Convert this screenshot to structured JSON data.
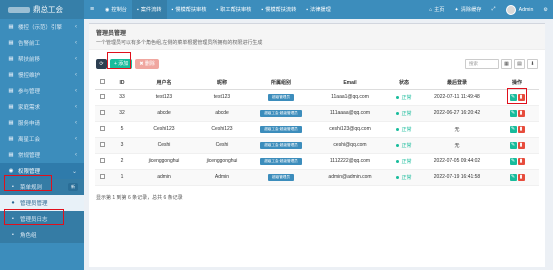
{
  "sidebar": {
    "logo_text": "鼎总工会",
    "items": [
      {
        "icon": "▦",
        "label": "楼控（示范）引擎",
        "arrow": "‹"
      },
      {
        "icon": "▦",
        "label": "告警前工",
        "arrow": "‹"
      },
      {
        "icon": "▦",
        "label": "帮扶前移",
        "arrow": "‹"
      },
      {
        "icon": "▦",
        "label": "慢控维护",
        "arrow": "‹"
      },
      {
        "icon": "▦",
        "label": "参与管理",
        "arrow": "‹"
      },
      {
        "icon": "▦",
        "label": "家庭需求",
        "arrow": "‹"
      },
      {
        "icon": "▦",
        "label": "服务申请",
        "arrow": "‹"
      },
      {
        "icon": "▦",
        "label": "离星工会",
        "arrow": "‹"
      },
      {
        "icon": "▦",
        "label": "常规管理",
        "arrow": "‹"
      },
      {
        "icon": "◉",
        "label": "权限管理",
        "arrow": "⌄"
      },
      {
        "icon": "▪",
        "label": "菜单规则",
        "badge": "新"
      },
      {
        "icon": "●",
        "label": "管理员管理"
      },
      {
        "icon": "▪",
        "label": "管理员日志"
      },
      {
        "icon": "▪",
        "label": "角色组"
      }
    ]
  },
  "topbar": {
    "burger": "≡",
    "tabs": [
      {
        "icon": "◉",
        "label": "控制台"
      },
      {
        "icon": "▪",
        "label": "案件流转"
      },
      {
        "icon": "▪",
        "label": "慢模帮扶审核"
      },
      {
        "icon": "▪",
        "label": "职工帮扶审核"
      },
      {
        "icon": "▪",
        "label": "慢模帮扶流转"
      },
      {
        "icon": "▪",
        "label": "法律援理"
      }
    ],
    "right": {
      "home": "主页",
      "clear_cache": "清除缓存",
      "fullscreen": "⤢",
      "user": "Admin",
      "settings": "⚙"
    }
  },
  "panel": {
    "title": "管理员管理",
    "desc": "一个管理员可以有多个角色组,左侧的菜单根据管理员所拥有的权限进行生成"
  },
  "toolbar": {
    "refresh": "⟳",
    "add": "+ 添加",
    "delete": "✖ 删除",
    "search_placeholder": "搜索",
    "view_icon": "▦",
    "columns_icon": "▤",
    "export_icon": "⬇"
  },
  "table": {
    "headers": [
      "",
      "ID",
      "用户名",
      "昵称",
      "所属组别",
      "Email",
      "状态",
      "最后登录",
      "操作"
    ],
    "rows": [
      {
        "id": "33",
        "username": "test123",
        "nickname": "test123",
        "group": "超级管理员",
        "email": "11aaa1@qq.com",
        "status": "正常",
        "last_login": "2022-07-11 11:49:48"
      },
      {
        "id": "32",
        "username": "abcde",
        "nickname": "abcde",
        "group": "超级工会·超级管理员",
        "email": "111aaaa@qq.com",
        "status": "正常",
        "last_login": "2022-06-27 16:20:42"
      },
      {
        "id": "5",
        "username": "Ceshi123",
        "nickname": "Ceshi123",
        "group": "超级工会·超级管理员",
        "email": "ceshi123@qq.com",
        "status": "正常",
        "last_login": "无"
      },
      {
        "id": "3",
        "username": "Ceshi",
        "nickname": "Ceshi",
        "group": "超级工会·超级管理员",
        "email": "ceshi@qq.com",
        "status": "正常",
        "last_login": "无"
      },
      {
        "id": "2",
        "username": "jicenggonghui",
        "nickname": "jicenggonghui",
        "group": "超级工会·超级管理员",
        "email": "1112222@qq.com",
        "status": "正常",
        "last_login": "2022-07-05 09:44:02"
      },
      {
        "id": "1",
        "username": "admin",
        "nickname": "Admin",
        "group": "超级管理员",
        "email": "admin@admin.com",
        "status": "正常",
        "last_login": "2022-07-19 16:41:58"
      }
    ],
    "edit_icon": "✎",
    "delete_icon": "▮"
  },
  "pager": {
    "text": "显示第 1 到第 6 条记录，总共 6 条记录"
  }
}
